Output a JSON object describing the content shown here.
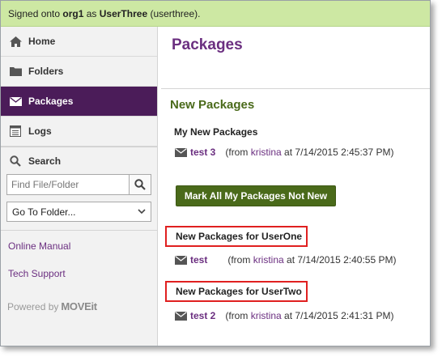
{
  "topbar": {
    "prefix": "Signed onto ",
    "org": "org1",
    "middle": " as ",
    "user": "UserThree",
    "suffix": " (userthree)."
  },
  "sidebar": {
    "nav": [
      {
        "label": "Home",
        "icon": "home-icon"
      },
      {
        "label": "Folders",
        "icon": "folder-icon"
      },
      {
        "label": "Packages",
        "icon": "envelope-icon",
        "active": true
      },
      {
        "label": "Logs",
        "icon": "log-icon"
      }
    ],
    "search_label": "Search",
    "search_placeholder": "Find File/Folder",
    "goto_selected": "Go To Folder...",
    "links": [
      "Online Manual",
      "Tech Support"
    ],
    "powered_by": "Powered by",
    "brand": "MOVEit"
  },
  "main": {
    "title": "Packages",
    "section": "New Packages",
    "groups": [
      {
        "title": "My New Packages",
        "items": [
          {
            "name": "test 3",
            "from_prefix": "(from ",
            "sender": "kristina",
            "date": " at 7/14/2015 2:45:37 PM)"
          }
        ]
      },
      {
        "title": "New Packages for UserOne",
        "items": [
          {
            "name": "test",
            "from_prefix": "(from ",
            "sender": "kristina",
            "date": " at 7/14/2015 2:40:55 PM)"
          }
        ]
      },
      {
        "title": "New Packages for UserTwo",
        "items": [
          {
            "name": "test 2",
            "from_prefix": "(from ",
            "sender": "kristina",
            "date": " at 7/14/2015 2:41:31 PM)"
          }
        ]
      }
    ],
    "mark_button": "Mark All My Packages Not New"
  },
  "colors": {
    "accent": "#4b1c59",
    "link": "#6b2f80",
    "green": "#4a6a1a",
    "topbar": "#cde8a3",
    "highlight": "#e02020"
  }
}
